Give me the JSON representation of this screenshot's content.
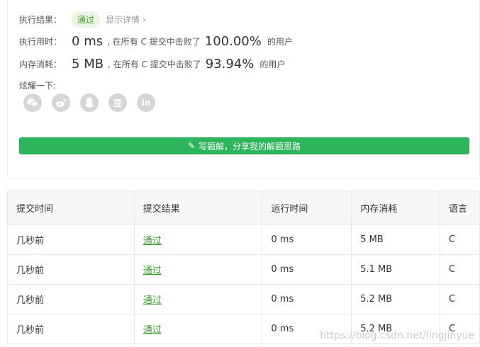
{
  "result": {
    "label": "执行结果：",
    "status": "通过",
    "detail": "显示详情 ›"
  },
  "runtime": {
    "label": "执行用时：",
    "value": "0 ms",
    "text": ", 在所有 C 提交中击败了",
    "percent": "100.00%",
    "users": "的用户"
  },
  "memory": {
    "label": "内存消耗：",
    "value": "5 MB",
    "text": ", 在所有 C 提交中击败了",
    "percent": "93.94%",
    "users": "的用户"
  },
  "share": {
    "label": "炫耀一下:",
    "icons": [
      "wechat-icon",
      "weibo-icon",
      "qq-icon",
      "douban-icon",
      "linkedin-icon"
    ],
    "douban_text": "豆",
    "linkedin_text": "in"
  },
  "write_button": "写题解，分享我的解题思路",
  "table": {
    "headers": [
      "提交时间",
      "提交结果",
      "运行时间",
      "内存消耗",
      "语言"
    ],
    "rows": [
      [
        "几秒前",
        "通过",
        "0 ms",
        "5 MB",
        "C"
      ],
      [
        "几秒前",
        "通过",
        "0 ms",
        "5.1 MB",
        "C"
      ],
      [
        "几秒前",
        "通过",
        "0 ms",
        "5.2 MB",
        "C"
      ],
      [
        "几秒前",
        "通过",
        "0 ms",
        "5.2 MB",
        "C"
      ]
    ]
  },
  "watermark": "https://blog.csdn.net/lingjinyue",
  "colors": {
    "accent_green": "#2db55d",
    "pass_text": "#3c9b2e",
    "icon_gray": "#d6d6d6"
  }
}
